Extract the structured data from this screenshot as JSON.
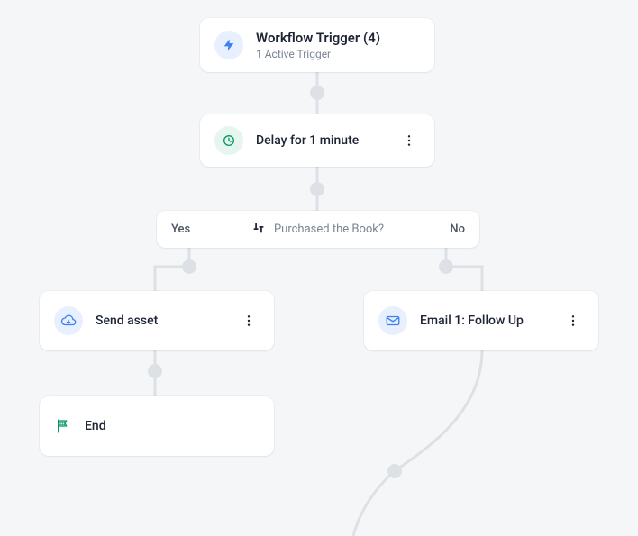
{
  "nodes": {
    "trigger": {
      "title": "Workflow Trigger (4)",
      "subtitle": "1 Active Trigger"
    },
    "delay": {
      "label": "Delay for 1 minute"
    },
    "condition": {
      "yes_label": "Yes",
      "no_label": "No",
      "question": "Purchased the Book?"
    },
    "send_asset": {
      "label": "Send asset"
    },
    "email1": {
      "label": "Email 1: Follow Up"
    },
    "end": {
      "label": "End"
    }
  }
}
